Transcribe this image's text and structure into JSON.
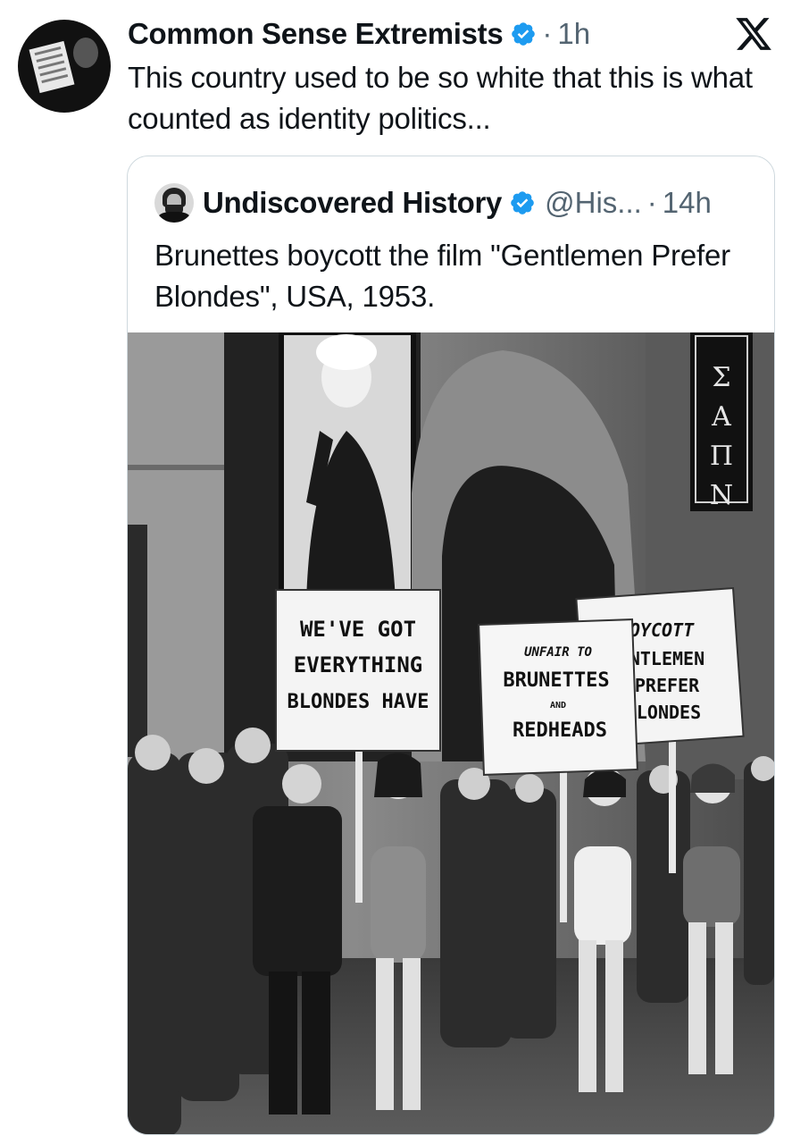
{
  "post": {
    "author_name": "Common Sense Extremists",
    "separator": "·",
    "timestamp": "1h",
    "text": "This country used to be so white that this is what counted as identity politics...",
    "avatar_icon": "avatar-man-reading-newspaper"
  },
  "close_icon": "x-logo-icon",
  "quoted": {
    "author_name": "Undiscovered History",
    "handle": "@His...",
    "separator": "·",
    "timestamp": "14h",
    "text": "Brunettes boycott the film \"Gentlemen Prefer Blondes\", USA, 1953.",
    "photo": {
      "signs": [
        {
          "lines": [
            "WE'VE GOT",
            "EVERYTHING",
            "BLONDES HAVE"
          ]
        },
        {
          "lines": [
            "UNFAIR TO",
            "BRUNETTES",
            "AND",
            "REDHEADS"
          ]
        },
        {
          "lines": [
            "OYCOTT",
            "NTLEMEN",
            "PREFER",
            "LONDES"
          ]
        }
      ],
      "marquee_text": "ΣΑΠΝ"
    }
  },
  "colors": {
    "text_primary": "#0f1419",
    "text_secondary": "#536471",
    "verified_blue": "#1d9bf0",
    "card_border": "#cfd9de"
  }
}
